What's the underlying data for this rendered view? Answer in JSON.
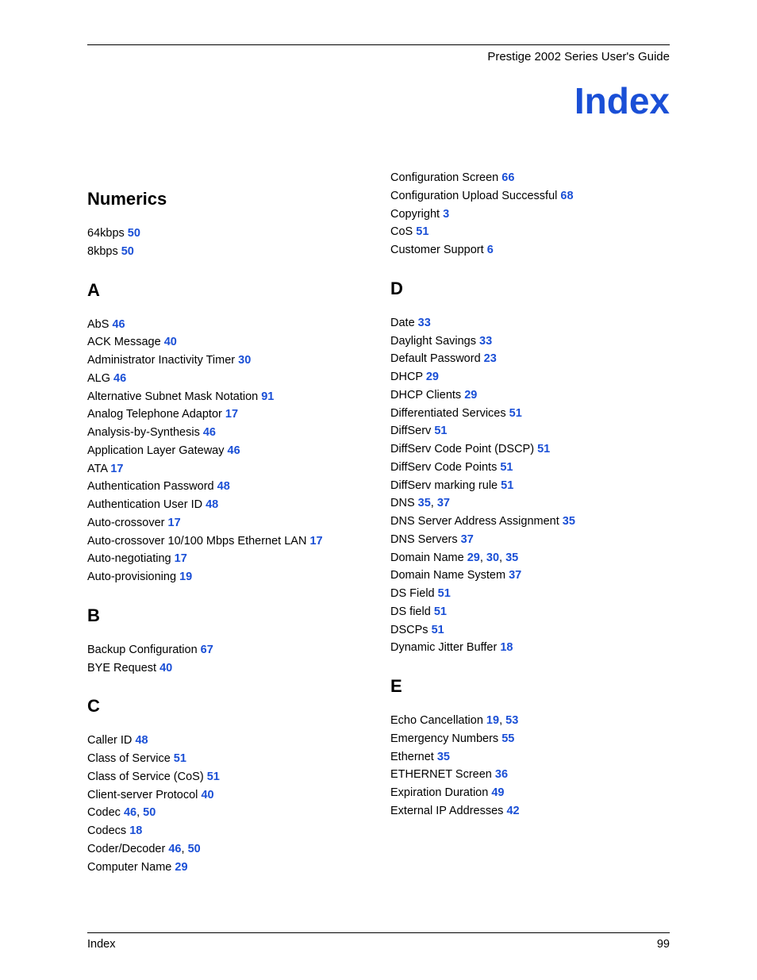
{
  "header": "Prestige 2002 Series User's Guide",
  "title": "Index",
  "footer_left": "Index",
  "footer_right": "99",
  "sections_left": [
    {
      "heading": "Numerics",
      "entries": [
        {
          "t": "64kbps",
          "p": [
            "50"
          ]
        },
        {
          "t": "8kbps",
          "p": [
            "50"
          ]
        }
      ]
    },
    {
      "heading": "A",
      "entries": [
        {
          "t": "AbS",
          "p": [
            "46"
          ]
        },
        {
          "t": "ACK Message",
          "p": [
            "40"
          ]
        },
        {
          "t": "Administrator Inactivity Timer",
          "p": [
            "30"
          ]
        },
        {
          "t": "ALG",
          "p": [
            "46"
          ]
        },
        {
          "t": "Alternative Subnet Mask Notation",
          "p": [
            "91"
          ]
        },
        {
          "t": "Analog Telephone Adaptor",
          "p": [
            "17"
          ]
        },
        {
          "t": "Analysis-by-Synthesis",
          "p": [
            "46"
          ]
        },
        {
          "t": "Application Layer Gateway",
          "p": [
            "46"
          ]
        },
        {
          "t": "ATA",
          "p": [
            "17"
          ]
        },
        {
          "t": "Authentication Password",
          "p": [
            "48"
          ]
        },
        {
          "t": "Authentication User ID",
          "p": [
            "48"
          ]
        },
        {
          "t": "Auto-crossover",
          "p": [
            "17"
          ]
        },
        {
          "t": "Auto-crossover 10/100 Mbps Ethernet LAN",
          "p": [
            "17"
          ]
        },
        {
          "t": "Auto-negotiating",
          "p": [
            "17"
          ]
        },
        {
          "t": "Auto-provisioning",
          "p": [
            "19"
          ]
        }
      ]
    },
    {
      "heading": "B",
      "entries": [
        {
          "t": "Backup Configuration",
          "p": [
            "67"
          ]
        },
        {
          "t": "BYE Request",
          "p": [
            "40"
          ]
        }
      ]
    },
    {
      "heading": "C",
      "entries": [
        {
          "t": "Caller ID",
          "p": [
            "48"
          ]
        },
        {
          "t": "Class of Service",
          "p": [
            "51"
          ]
        },
        {
          "t": "Class of Service (CoS)",
          "p": [
            "51"
          ]
        },
        {
          "t": "Client-server Protocol",
          "p": [
            "40"
          ]
        },
        {
          "t": "Codec",
          "p": [
            "46",
            "50"
          ]
        },
        {
          "t": "Codecs",
          "p": [
            "18"
          ]
        },
        {
          "t": "Coder/Decoder",
          "p": [
            "46",
            "50"
          ]
        },
        {
          "t": "Computer Name",
          "p": [
            "29"
          ]
        }
      ]
    }
  ],
  "sections_right": [
    {
      "heading": "",
      "entries": [
        {
          "t": "Configuration Screen",
          "p": [
            "66"
          ]
        },
        {
          "t": "Configuration Upload Successful",
          "p": [
            "68"
          ]
        },
        {
          "t": "Copyright",
          "p": [
            "3"
          ]
        },
        {
          "t": "CoS",
          "p": [
            "51"
          ]
        },
        {
          "t": "Customer Support",
          "p": [
            "6"
          ]
        }
      ]
    },
    {
      "heading": "D",
      "entries": [
        {
          "t": "Date",
          "p": [
            "33"
          ]
        },
        {
          "t": "Daylight Savings",
          "p": [
            "33"
          ]
        },
        {
          "t": "Default Password",
          "p": [
            "23"
          ]
        },
        {
          "t": "DHCP",
          "p": [
            "29"
          ]
        },
        {
          "t": "DHCP Clients",
          "p": [
            "29"
          ]
        },
        {
          "t": "Differentiated Services",
          "p": [
            "51"
          ]
        },
        {
          "t": "DiffServ",
          "p": [
            "51"
          ]
        },
        {
          "t": "DiffServ Code Point (DSCP)",
          "p": [
            "51"
          ]
        },
        {
          "t": "DiffServ Code Points",
          "p": [
            "51"
          ]
        },
        {
          "t": "DiffServ marking rule",
          "p": [
            "51"
          ]
        },
        {
          "t": "DNS",
          "p": [
            "35",
            "37"
          ]
        },
        {
          "t": "DNS Server Address Assignment",
          "p": [
            "35"
          ]
        },
        {
          "t": "DNS Servers",
          "p": [
            "37"
          ]
        },
        {
          "t": "Domain Name",
          "p": [
            "29",
            "30",
            "35"
          ]
        },
        {
          "t": "Domain Name System",
          "p": [
            "37"
          ]
        },
        {
          "t": "DS Field",
          "p": [
            "51"
          ]
        },
        {
          "t": "DS field",
          "p": [
            "51"
          ]
        },
        {
          "t": "DSCPs",
          "p": [
            "51"
          ]
        },
        {
          "t": "Dynamic Jitter Buffer",
          "p": [
            "18"
          ]
        }
      ]
    },
    {
      "heading": "E",
      "entries": [
        {
          "t": "Echo Cancellation",
          "p": [
            "19",
            "53"
          ]
        },
        {
          "t": "Emergency Numbers",
          "p": [
            "55"
          ]
        },
        {
          "t": "Ethernet",
          "p": [
            "35"
          ]
        },
        {
          "t": "ETHERNET Screen",
          "p": [
            "36"
          ]
        },
        {
          "t": "Expiration Duration",
          "p": [
            "49"
          ]
        },
        {
          "t": "External IP Addresses",
          "p": [
            "42"
          ]
        }
      ]
    }
  ]
}
